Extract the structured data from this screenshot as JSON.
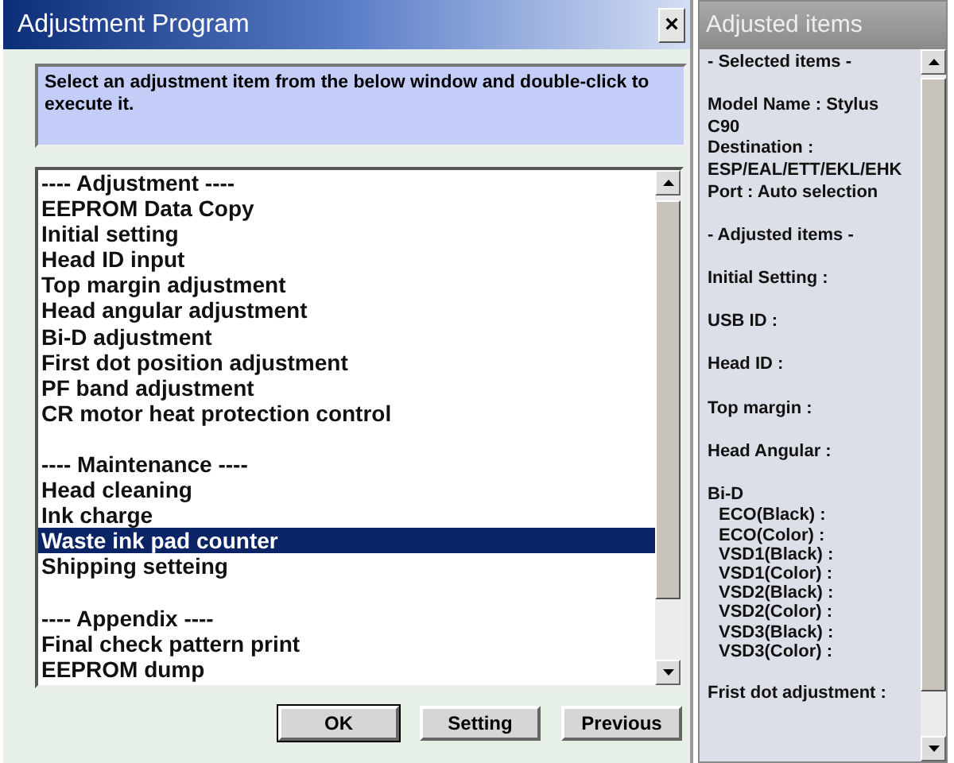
{
  "window": {
    "title": "Adjustment Program",
    "close": "×"
  },
  "instruction": "Select an adjustment item from the below window and double-click to execute it.",
  "items": [
    {
      "label": "---- Adjustment ----",
      "selected": false,
      "spaced": false
    },
    {
      "label": "EEPROM Data Copy",
      "selected": false,
      "spaced": false
    },
    {
      "label": "Initial setting",
      "selected": false,
      "spaced": false
    },
    {
      "label": "Head ID input",
      "selected": false,
      "spaced": false
    },
    {
      "label": "Top margin adjustment",
      "selected": false,
      "spaced": false
    },
    {
      "label": "Head angular adjustment",
      "selected": false,
      "spaced": false
    },
    {
      "label": "Bi-D adjustment",
      "selected": false,
      "spaced": false
    },
    {
      "label": "First dot position adjustment",
      "selected": false,
      "spaced": false
    },
    {
      "label": "PF band adjustment",
      "selected": false,
      "spaced": false
    },
    {
      "label": "CR motor heat protection control",
      "selected": false,
      "spaced": false
    },
    {
      "label": "---- Maintenance ----",
      "selected": false,
      "spaced": true
    },
    {
      "label": "Head cleaning",
      "selected": false,
      "spaced": false
    },
    {
      "label": "Ink charge",
      "selected": false,
      "spaced": false
    },
    {
      "label": "Waste ink pad counter",
      "selected": true,
      "spaced": false
    },
    {
      "label": "Shipping setteing",
      "selected": false,
      "spaced": false
    },
    {
      "label": "---- Appendix ----",
      "selected": false,
      "spaced": true
    },
    {
      "label": "Final check pattern print",
      "selected": false,
      "spaced": false
    },
    {
      "label": "EEPROM dump",
      "selected": false,
      "spaced": false
    }
  ],
  "buttons": [
    "OK",
    "Setting",
    "Previous"
  ],
  "side_panel": {
    "title": "Adjusted items",
    "lines": [
      {
        "text": "- Selected items -",
        "spaced": false,
        "indent": false
      },
      {
        "text": "Model Name : Stylus",
        "spaced": true,
        "indent": false
      },
      {
        "text": "C90",
        "spaced": false,
        "indent": false
      },
      {
        "text": "Destination :",
        "spaced": false,
        "indent": false
      },
      {
        "text": "ESP/EAL/ETT/EKL/EHK",
        "spaced": false,
        "indent": false
      },
      {
        "text": "Port : Auto selection",
        "spaced": false,
        "indent": false
      },
      {
        "text": "- Adjusted items -",
        "spaced": true,
        "indent": false
      },
      {
        "text": "Initial Setting :",
        "spaced": true,
        "indent": false
      },
      {
        "text": "USB ID :",
        "spaced": true,
        "indent": false
      },
      {
        "text": "Head ID :",
        "spaced": true,
        "indent": false
      },
      {
        "text": "Top margin :",
        "spaced": true,
        "indent": false
      },
      {
        "text": "Head Angular :",
        "spaced": true,
        "indent": false
      },
      {
        "text": "Bi-D",
        "spaced": true,
        "indent": false
      },
      {
        "text": "ECO(Black)  :",
        "spaced": false,
        "indent": true
      },
      {
        "text": "ECO(Color)  :",
        "spaced": false,
        "indent": true
      },
      {
        "text": "VSD1(Black) :",
        "spaced": false,
        "indent": true
      },
      {
        "text": "VSD1(Color) :",
        "spaced": false,
        "indent": true
      },
      {
        "text": "VSD2(Black) :",
        "spaced": false,
        "indent": true
      },
      {
        "text": "VSD2(Color) :",
        "spaced": false,
        "indent": true
      },
      {
        "text": "VSD3(Black) :",
        "spaced": false,
        "indent": true
      },
      {
        "text": "VSD3(Color) :",
        "spaced": false,
        "indent": true
      },
      {
        "text": "Frist dot adjustment :",
        "spaced": true,
        "indent": false
      }
    ]
  }
}
